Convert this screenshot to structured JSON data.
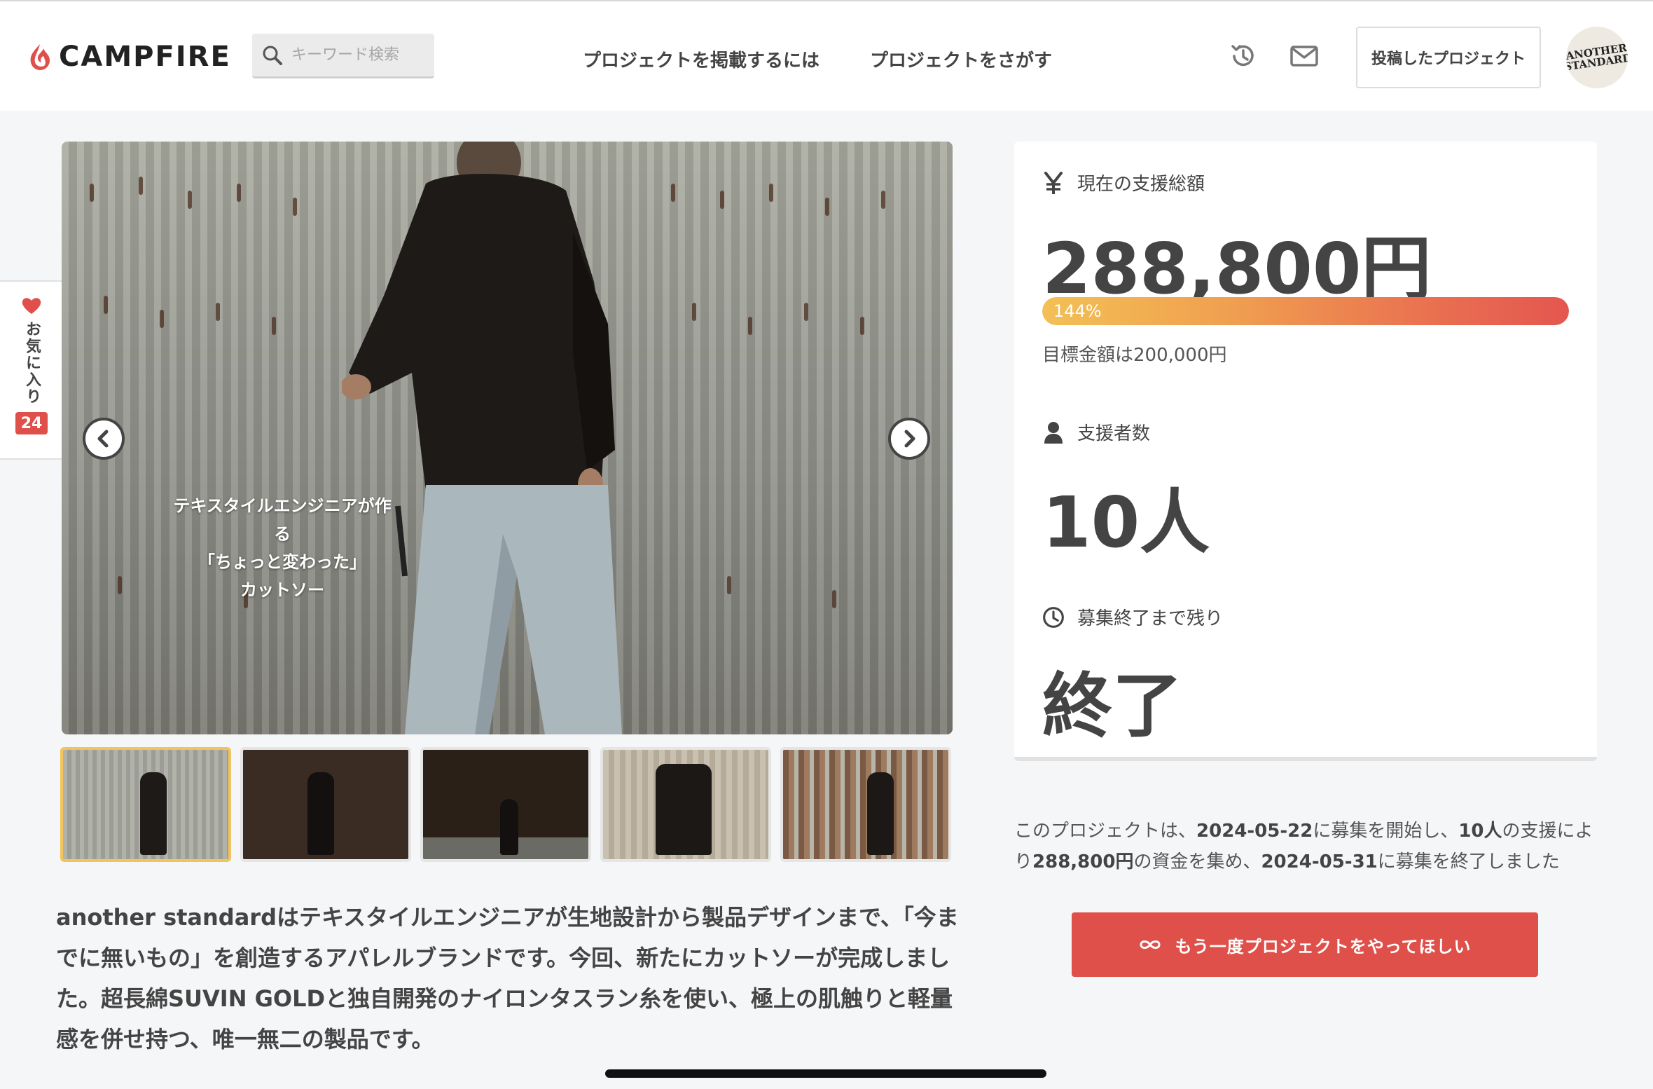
{
  "header": {
    "logo_text": "CAMPFIRE",
    "search_placeholder": "キーワード検索",
    "nav": [
      "プロジェクトを掲載するには",
      "プロジェクトをさがす"
    ],
    "posted_projects_label": "投稿したプロジェクト",
    "avatar_text": "ANOTHER STANDARD",
    "icons": [
      "history-icon",
      "mail-icon",
      "search-icon"
    ]
  },
  "favorite": {
    "label": "お気に入り",
    "count": "24"
  },
  "gallery": {
    "caption_lines": [
      "テキスタイルエンジニアが作る",
      "「ちょっと変わった」",
      "カットソー"
    ],
    "thumbnail_count": 5,
    "active_thumbnail": 1
  },
  "description": "another standardはテキスタイルエンジニアが生地設計から製品デザインまで、「今までに無いもの」を創造するアパレルブランドです。今回、新たにカットソーが完成しました。超長綿SUVIN GOLDと独自開発のナイロンタスラン糸を使い、極上の肌触りと軽量感を併せ持つ、唯一無二の製品です。",
  "stats": {
    "total_label": "現在の支援総額",
    "total_value": "288,800円",
    "progress_percent": 144,
    "progress_label": "144%",
    "goal_text": "目標金額は200,000円",
    "backers_label": "支援者数",
    "backers_value": "10人",
    "remaining_label": "募集終了まで残り",
    "remaining_value": "終了"
  },
  "summary": {
    "p1": "このプロジェクトは、",
    "start_date": "2024-05-22",
    "p2": "に募集を開始し、",
    "backers": "10人",
    "p3": "の支援により",
    "amount": "288,800円",
    "p4": "の資金を集め、",
    "end_date": "2024-05-31",
    "p5": "に募集を終了しました"
  },
  "rerun_button_label": "もう一度プロジェクトをやってほしい",
  "colors": {
    "accent_red": "#e0504a",
    "progress_start": "#f3c055",
    "progress_end": "#e45650",
    "active_thumb_border": "#f3c35c"
  }
}
